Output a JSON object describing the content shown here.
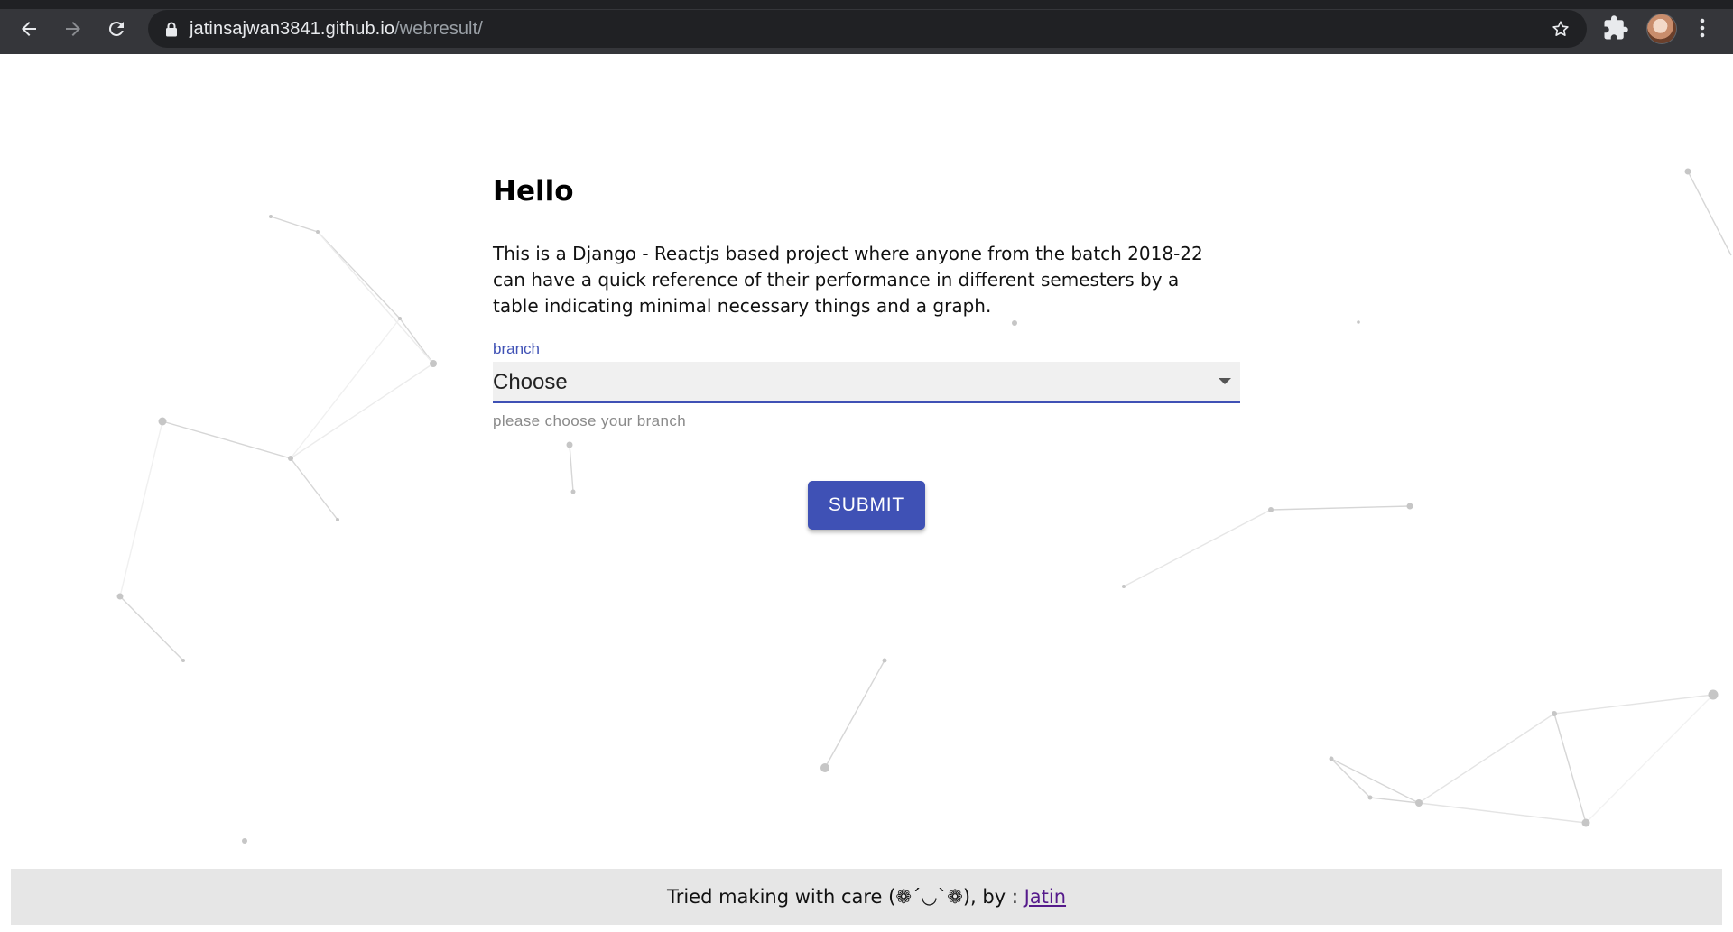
{
  "browser": {
    "url_host": "jatinsajwan3841.github.io",
    "url_path": "/webresult/",
    "icons": [
      "back-icon",
      "forward-icon",
      "reload-icon",
      "lock-icon",
      "star-icon",
      "extensions-icon",
      "profile-avatar",
      "kebab-menu-icon"
    ]
  },
  "page": {
    "heading": "Hello",
    "description": "This is a Django - Reactjs based project where anyone from the batch 2018-22 can have a quick reference of their performance in different semesters by a table indicating minimal necessary things and a graph.",
    "branch_field": {
      "label": "branch",
      "selected": "Choose",
      "helper": "please choose your branch"
    },
    "submit_label": "SUBMIT"
  },
  "footer": {
    "text": "Tried making with care (❁´◡`❁), by : ",
    "link_text": "Jatin"
  },
  "colors": {
    "accent": "#3f51b5",
    "chrome_bg": "#35363a",
    "omnibox_bg": "#202124",
    "footer_bg": "#e6e6e6",
    "particles": "#c8c8c8"
  }
}
